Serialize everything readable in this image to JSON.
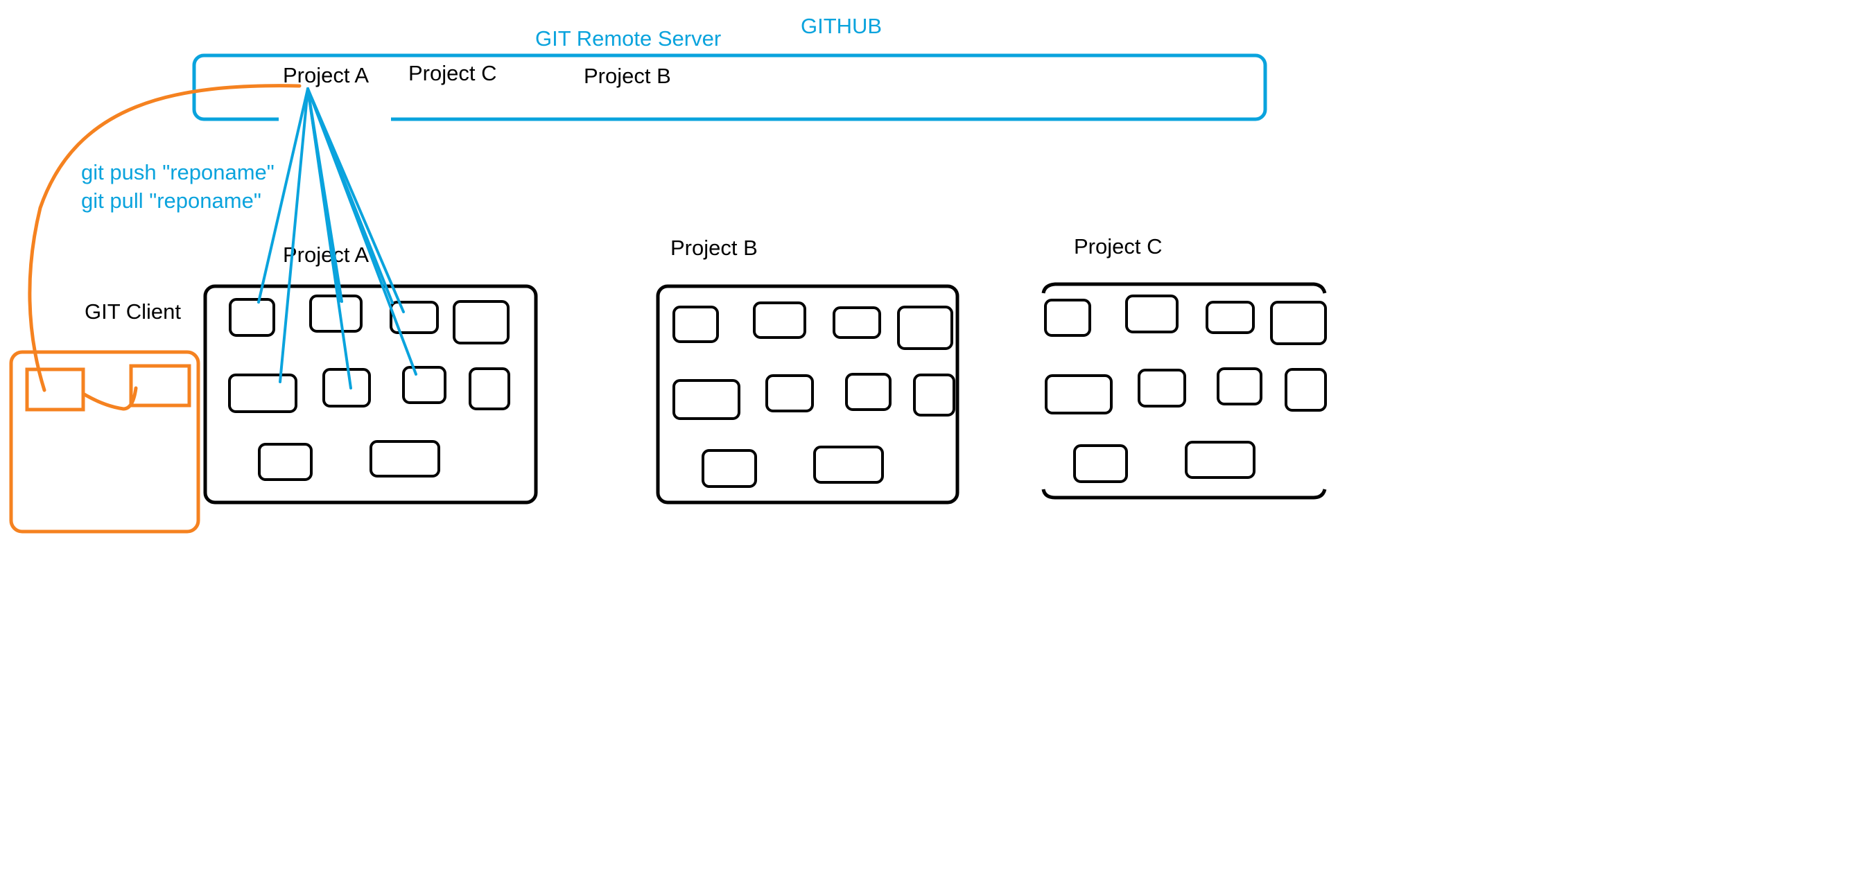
{
  "colors": {
    "ink": "#000000",
    "remote": "#0aa3dd",
    "client": "#f58220",
    "background": "#ffffff"
  },
  "remote": {
    "github_label": "GITHUB",
    "server_label": "GIT Remote Server",
    "projects": [
      "Project A",
      "Project C",
      "Project B"
    ]
  },
  "commands": {
    "push": "git push \"reponame\"",
    "pull": "git pull  \"reponame\""
  },
  "client": {
    "label": "GIT Client"
  },
  "local_projects": [
    {
      "title": "Project A"
    },
    {
      "title": "Project B"
    },
    {
      "title": "Project C"
    }
  ]
}
